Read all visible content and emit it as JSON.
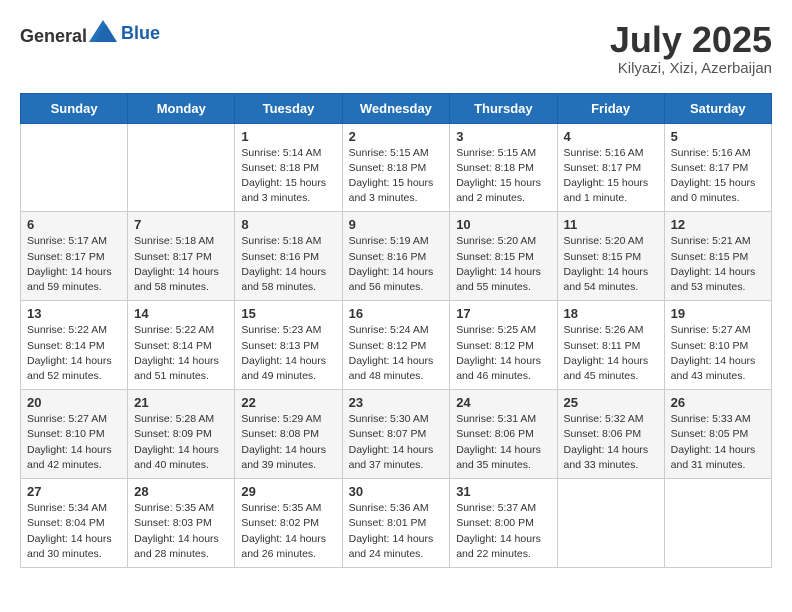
{
  "header": {
    "logo_general": "General",
    "logo_blue": "Blue",
    "month": "July 2025",
    "location": "Kilyazi, Xizi, Azerbaijan"
  },
  "weekdays": [
    "Sunday",
    "Monday",
    "Tuesday",
    "Wednesday",
    "Thursday",
    "Friday",
    "Saturday"
  ],
  "weeks": [
    [
      {
        "day": "",
        "info": ""
      },
      {
        "day": "",
        "info": ""
      },
      {
        "day": "1",
        "info": "Sunrise: 5:14 AM\nSunset: 8:18 PM\nDaylight: 15 hours\nand 3 minutes."
      },
      {
        "day": "2",
        "info": "Sunrise: 5:15 AM\nSunset: 8:18 PM\nDaylight: 15 hours\nand 3 minutes."
      },
      {
        "day": "3",
        "info": "Sunrise: 5:15 AM\nSunset: 8:18 PM\nDaylight: 15 hours\nand 2 minutes."
      },
      {
        "day": "4",
        "info": "Sunrise: 5:16 AM\nSunset: 8:17 PM\nDaylight: 15 hours\nand 1 minute."
      },
      {
        "day": "5",
        "info": "Sunrise: 5:16 AM\nSunset: 8:17 PM\nDaylight: 15 hours\nand 0 minutes."
      }
    ],
    [
      {
        "day": "6",
        "info": "Sunrise: 5:17 AM\nSunset: 8:17 PM\nDaylight: 14 hours\nand 59 minutes."
      },
      {
        "day": "7",
        "info": "Sunrise: 5:18 AM\nSunset: 8:17 PM\nDaylight: 14 hours\nand 58 minutes."
      },
      {
        "day": "8",
        "info": "Sunrise: 5:18 AM\nSunset: 8:16 PM\nDaylight: 14 hours\nand 58 minutes."
      },
      {
        "day": "9",
        "info": "Sunrise: 5:19 AM\nSunset: 8:16 PM\nDaylight: 14 hours\nand 56 minutes."
      },
      {
        "day": "10",
        "info": "Sunrise: 5:20 AM\nSunset: 8:15 PM\nDaylight: 14 hours\nand 55 minutes."
      },
      {
        "day": "11",
        "info": "Sunrise: 5:20 AM\nSunset: 8:15 PM\nDaylight: 14 hours\nand 54 minutes."
      },
      {
        "day": "12",
        "info": "Sunrise: 5:21 AM\nSunset: 8:15 PM\nDaylight: 14 hours\nand 53 minutes."
      }
    ],
    [
      {
        "day": "13",
        "info": "Sunrise: 5:22 AM\nSunset: 8:14 PM\nDaylight: 14 hours\nand 52 minutes."
      },
      {
        "day": "14",
        "info": "Sunrise: 5:22 AM\nSunset: 8:14 PM\nDaylight: 14 hours\nand 51 minutes."
      },
      {
        "day": "15",
        "info": "Sunrise: 5:23 AM\nSunset: 8:13 PM\nDaylight: 14 hours\nand 49 minutes."
      },
      {
        "day": "16",
        "info": "Sunrise: 5:24 AM\nSunset: 8:12 PM\nDaylight: 14 hours\nand 48 minutes."
      },
      {
        "day": "17",
        "info": "Sunrise: 5:25 AM\nSunset: 8:12 PM\nDaylight: 14 hours\nand 46 minutes."
      },
      {
        "day": "18",
        "info": "Sunrise: 5:26 AM\nSunset: 8:11 PM\nDaylight: 14 hours\nand 45 minutes."
      },
      {
        "day": "19",
        "info": "Sunrise: 5:27 AM\nSunset: 8:10 PM\nDaylight: 14 hours\nand 43 minutes."
      }
    ],
    [
      {
        "day": "20",
        "info": "Sunrise: 5:27 AM\nSunset: 8:10 PM\nDaylight: 14 hours\nand 42 minutes."
      },
      {
        "day": "21",
        "info": "Sunrise: 5:28 AM\nSunset: 8:09 PM\nDaylight: 14 hours\nand 40 minutes."
      },
      {
        "day": "22",
        "info": "Sunrise: 5:29 AM\nSunset: 8:08 PM\nDaylight: 14 hours\nand 39 minutes."
      },
      {
        "day": "23",
        "info": "Sunrise: 5:30 AM\nSunset: 8:07 PM\nDaylight: 14 hours\nand 37 minutes."
      },
      {
        "day": "24",
        "info": "Sunrise: 5:31 AM\nSunset: 8:06 PM\nDaylight: 14 hours\nand 35 minutes."
      },
      {
        "day": "25",
        "info": "Sunrise: 5:32 AM\nSunset: 8:06 PM\nDaylight: 14 hours\nand 33 minutes."
      },
      {
        "day": "26",
        "info": "Sunrise: 5:33 AM\nSunset: 8:05 PM\nDaylight: 14 hours\nand 31 minutes."
      }
    ],
    [
      {
        "day": "27",
        "info": "Sunrise: 5:34 AM\nSunset: 8:04 PM\nDaylight: 14 hours\nand 30 minutes."
      },
      {
        "day": "28",
        "info": "Sunrise: 5:35 AM\nSunset: 8:03 PM\nDaylight: 14 hours\nand 28 minutes."
      },
      {
        "day": "29",
        "info": "Sunrise: 5:35 AM\nSunset: 8:02 PM\nDaylight: 14 hours\nand 26 minutes."
      },
      {
        "day": "30",
        "info": "Sunrise: 5:36 AM\nSunset: 8:01 PM\nDaylight: 14 hours\nand 24 minutes."
      },
      {
        "day": "31",
        "info": "Sunrise: 5:37 AM\nSunset: 8:00 PM\nDaylight: 14 hours\nand 22 minutes."
      },
      {
        "day": "",
        "info": ""
      },
      {
        "day": "",
        "info": ""
      }
    ]
  ]
}
